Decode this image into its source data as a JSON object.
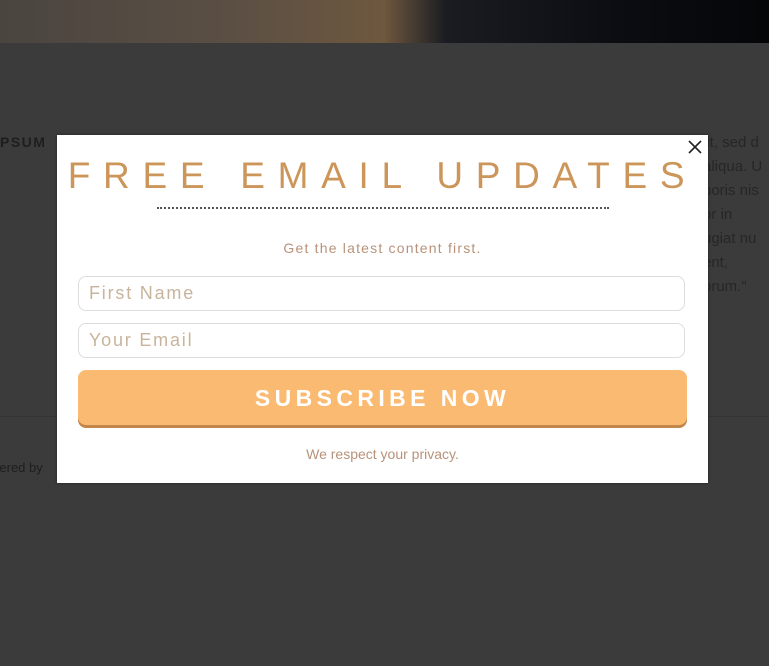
{
  "background": {
    "heading": "PSUM",
    "body_lines": [
      "lit, sed d",
      "aliqua. U",
      "boris nis",
      "or in",
      "ugiat nu",
      "ent,",
      "orum.\""
    ],
    "footer_text": "wered by"
  },
  "popup": {
    "title": "FREE EMAIL UPDATES",
    "subtitle": "Get the latest content first.",
    "first_name_placeholder": "First Name",
    "email_placeholder": "Your Email",
    "subscribe_label": "SUBSCRIBE NOW",
    "privacy_text": "We respect your privacy.",
    "close_icon": "close-icon"
  },
  "colors": {
    "accent": "#cc9559",
    "button": "#fbba72",
    "overlay": "#3a3a3a"
  }
}
